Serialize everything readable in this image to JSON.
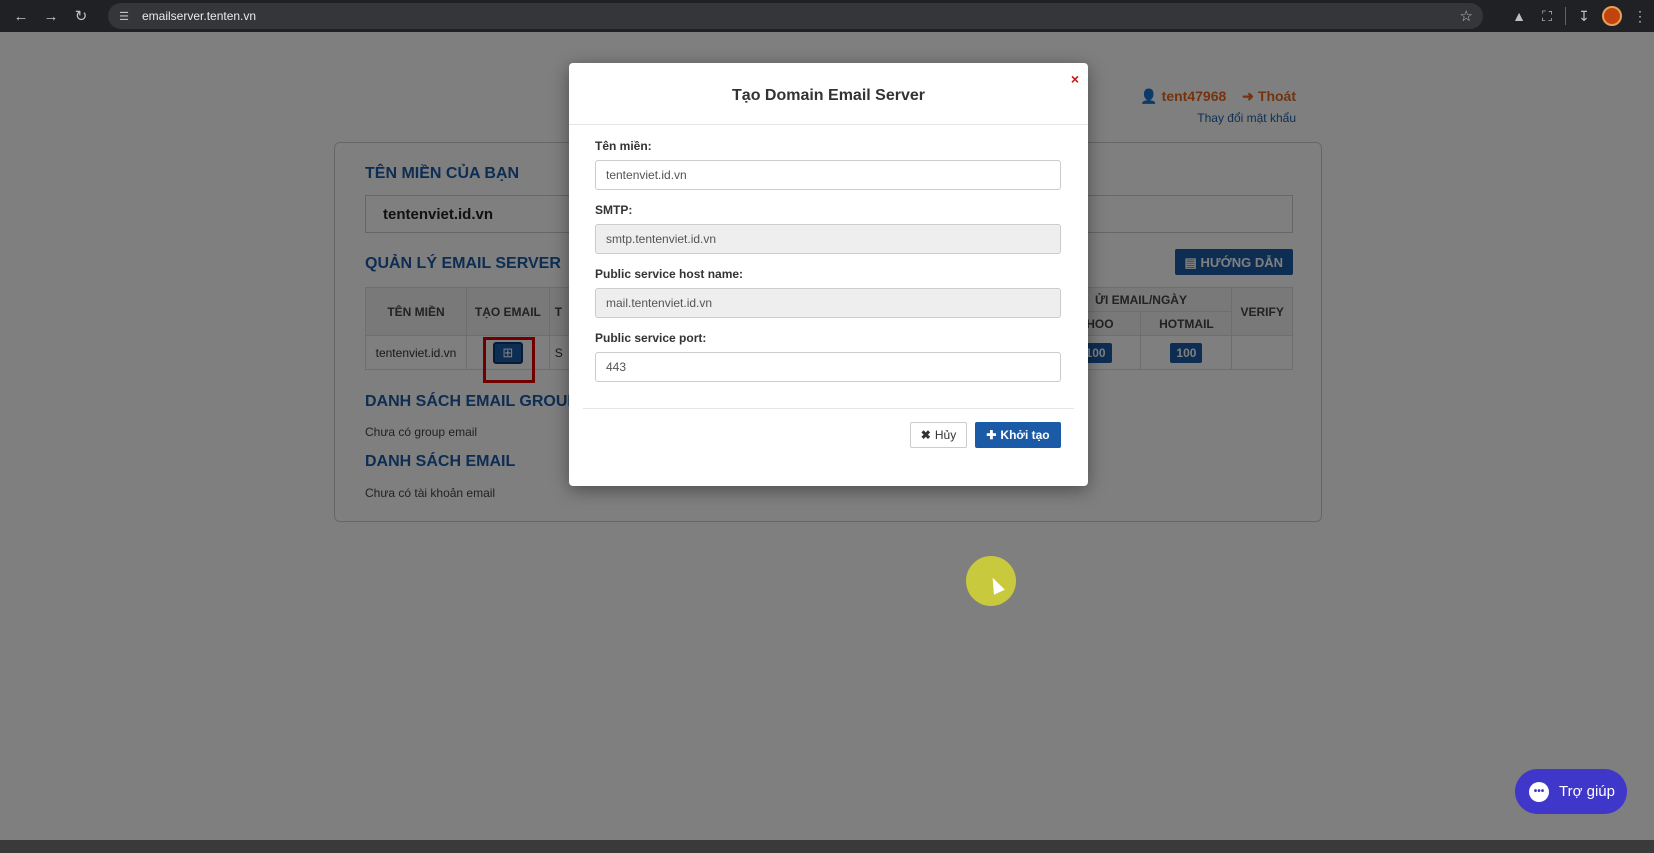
{
  "browser": {
    "url": "emailserver.tenten.vn"
  },
  "header": {
    "username": "tent47968",
    "logout": "Thoát",
    "change_password": "Thay đổi mật khẩu"
  },
  "domain_section": {
    "title": "TÊN MIỀN CỦA BẠN",
    "domain": "tentenviet.id.vn"
  },
  "manage_section": {
    "title": "QUẢN LÝ EMAIL SERVER",
    "guide_button": "HƯỚNG DẪN",
    "columns": {
      "domain": "TÊN MIỀN",
      "create_email": "TẠO EMAIL",
      "col3_partial": "T",
      "limit_partial": "ỬI EMAIL/NGÀY",
      "yahoo_partial": "AHOO",
      "hotmail": "HOTMAIL",
      "verify": "VERIFY"
    },
    "row": {
      "domain": "tentenviet.id.vn",
      "col3_partial": "S",
      "yahoo_limit": "100",
      "hotmail_limit": "100"
    }
  },
  "group_section": {
    "title": "DANH SÁCH EMAIL GROUP",
    "empty": "Chưa có group email"
  },
  "email_section": {
    "title": "DANH SÁCH EMAIL",
    "empty": "Chưa có tài khoản email"
  },
  "modal": {
    "title": "Tạo Domain Email Server",
    "close": "×",
    "fields": [
      {
        "label": "Tên miền:",
        "value": "tentenviet.id.vn"
      },
      {
        "label": "SMTP:",
        "value": "smtp.tentenviet.id.vn"
      },
      {
        "label": "Public service host name:",
        "value": "mail.tentenviet.id.vn"
      },
      {
        "label": "Public service port:",
        "value": "443"
      }
    ],
    "cancel": "Hủy",
    "create": "Khởi tạo"
  },
  "help_widget": {
    "label": "Trợ giúp"
  },
  "colors": {
    "primary": "#1b5aa6",
    "accent": "#e8671c",
    "close": "#cc1111",
    "help": "#3f37c9"
  }
}
